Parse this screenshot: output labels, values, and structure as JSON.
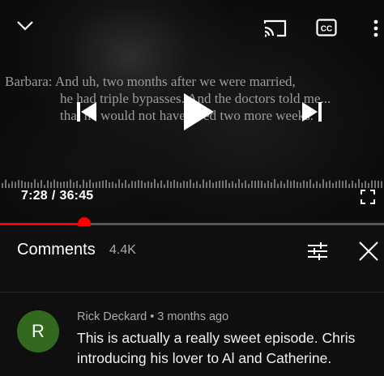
{
  "player": {
    "subtitle_lines": [
      "Barbara: And uh, two months after we were married,",
      "he had triple bypasses. And the doctors told me...",
      "that he would not have lived two more weeks."
    ],
    "time_current": "7:28",
    "time_separator": "/",
    "time_total": "36:45",
    "progress_fraction": 0.22
  },
  "comments_panel": {
    "title": "Comments",
    "count": "4.4K"
  },
  "comment": {
    "avatar_letter": "R",
    "avatar_color": "#33691e",
    "author": "Rick Deckard",
    "separator": "•",
    "time": "3 months ago",
    "text": "This is actually a really sweet episode. Chris introducing his lover to Al and Catherine."
  },
  "icons": {
    "collapse": "chevron-down-icon",
    "cast": "cast-icon",
    "captions": "closed-captions-icon",
    "more": "more-vertical-icon",
    "previous": "skip-previous-icon",
    "play": "play-icon",
    "next": "skip-next-icon",
    "fullscreen": "fullscreen-icon",
    "sort": "sort-filter-icon",
    "close": "close-icon"
  },
  "colors": {
    "progress": "#ff0000",
    "background": "#0f0f0f"
  }
}
